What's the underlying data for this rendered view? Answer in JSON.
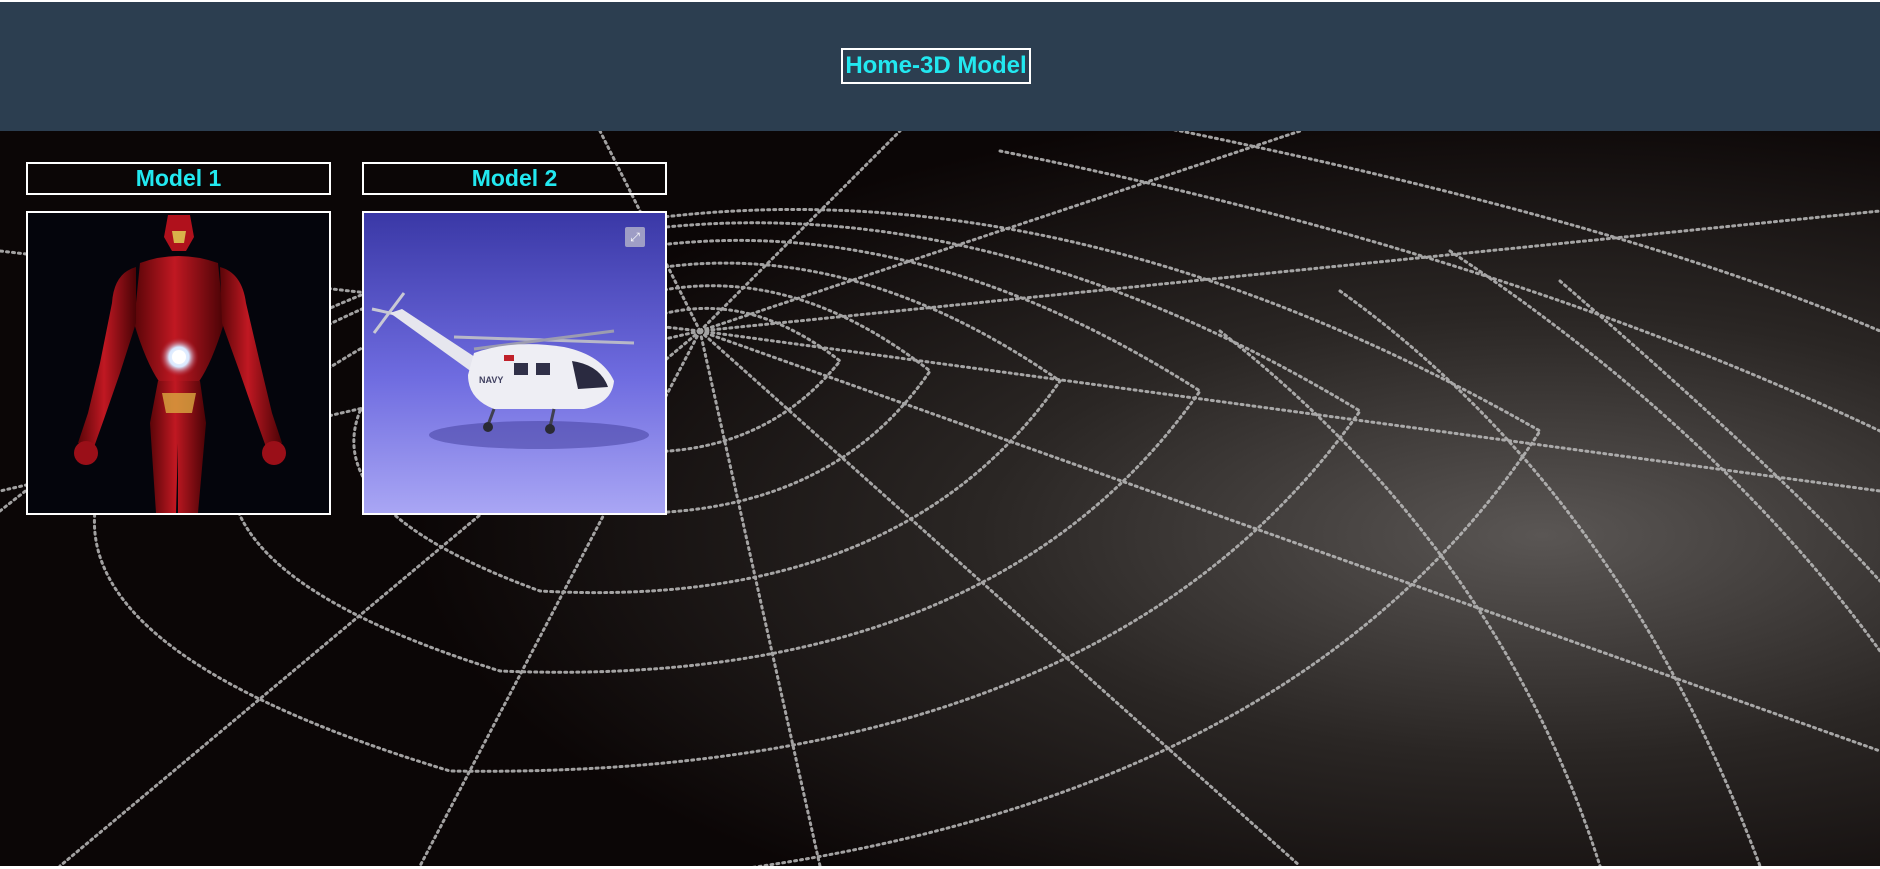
{
  "header": {
    "title": "Home-3D Model",
    "background_color": "#2c3e50",
    "title_color": "#22e8f0"
  },
  "models": [
    {
      "label": "Model 1",
      "image": "iron-man-armor-figure"
    },
    {
      "label": "Model 2",
      "image": "navy-helicopter-3d-render",
      "expand_icon": "expand-icon"
    }
  ],
  "background": {
    "image": "dewy-spider-web-photo"
  }
}
